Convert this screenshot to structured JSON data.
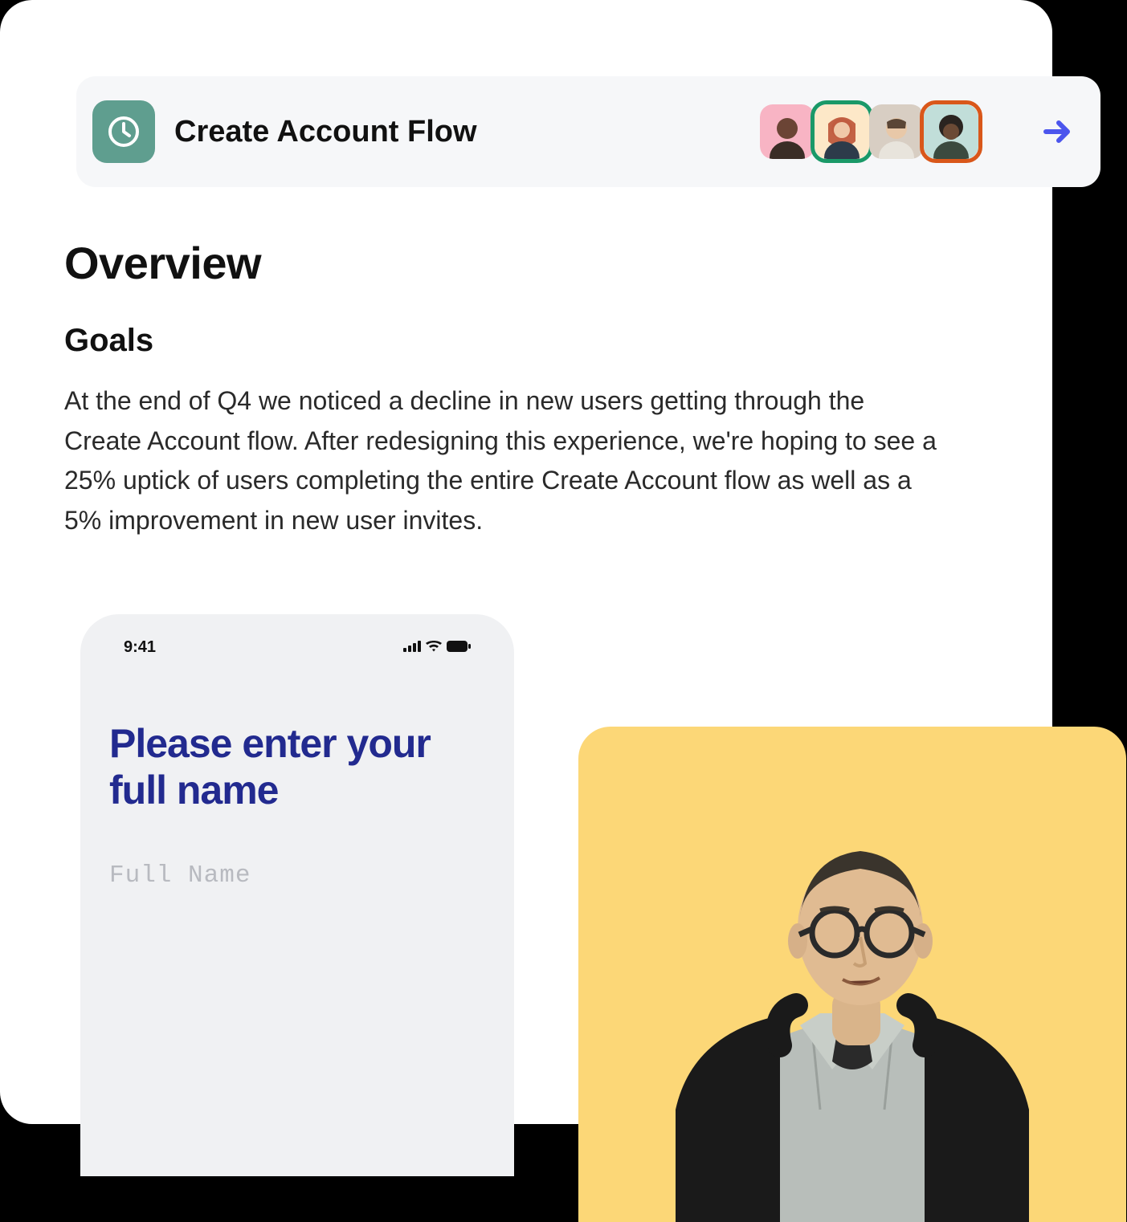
{
  "header": {
    "title": "Create Account Flow",
    "icon": "clock-icon",
    "avatar_count": 4
  },
  "content": {
    "overview_heading": "Overview",
    "goals_heading": "Goals",
    "goals_body": "At the end of Q4 we noticed a decline in new users getting through the Create Account flow. After redesigning this experience, we're hoping to see a 25% uptick of users completing the entire Create Account flow as well as a 5% improvement in new user invites."
  },
  "phone": {
    "time": "9:41",
    "heading": "Please enter your full name",
    "input_placeholder": "Full Name"
  },
  "colors": {
    "header_icon_bg": "#5f9e8f",
    "phone_heading": "#222a8f",
    "feature_bg": "#fcd777",
    "arrow": "#4b55ed"
  }
}
